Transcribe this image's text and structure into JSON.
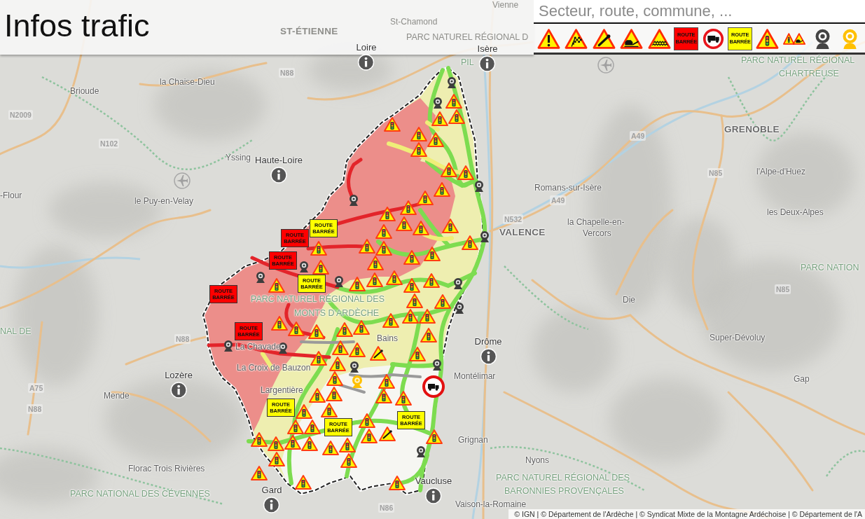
{
  "header": {
    "title": "Infos trafic"
  },
  "search": {
    "placeholder": "Secteur, route, commune, ..."
  },
  "filters": [
    {
      "kind": "danger"
    },
    {
      "kind": "checkered"
    },
    {
      "kind": "tool"
    },
    {
      "kind": "vehicle"
    },
    {
      "kind": "waves"
    },
    {
      "kind": "closure",
      "label": "ROUTE BARRÉE",
      "color": "#ff0000"
    },
    {
      "kind": "prohibition"
    },
    {
      "kind": "closure",
      "label": "ROUTE BARRÉE",
      "color": "#ffff00"
    },
    {
      "kind": "signal"
    },
    {
      "kind": "signals"
    },
    {
      "kind": "webcam",
      "color": "#444444"
    },
    {
      "kind": "webcam",
      "color": "#ffc000"
    }
  ],
  "map": {
    "places": [
      {
        "name": "Vienne",
        "kind": "town"
      },
      {
        "name": "ST-ÉTIENNE",
        "kind": "major"
      },
      {
        "name": "St-Chamond",
        "kind": "town"
      },
      {
        "name": "PARC NATUREL RÉGIONAL D",
        "kind": "park"
      },
      {
        "name": "PIL",
        "kind": "park"
      },
      {
        "name": "Brioude",
        "kind": "town"
      },
      {
        "name": "la Chaise-Dieu",
        "kind": "town"
      },
      {
        "name": "N88",
        "kind": "shield"
      },
      {
        "name": "N2009",
        "kind": "shield"
      },
      {
        "name": "N102",
        "kind": "shield"
      },
      {
        "name": "Yssing",
        "kind": "town"
      },
      {
        "name": "PARC NATUREL RÉGIONAL",
        "kind": "park"
      },
      {
        "name": "CHARTREUSE",
        "kind": "park"
      },
      {
        "name": "GRENOBLE",
        "kind": "major"
      },
      {
        "name": "A49",
        "kind": "shield"
      },
      {
        "name": "N85",
        "kind": "shield"
      },
      {
        "name": "l'Alpe-d'Huez",
        "kind": "town"
      },
      {
        "name": "Romans-sur-Isère",
        "kind": "town"
      },
      {
        "name": "A49",
        "kind": "shield"
      },
      {
        "name": "les Deux-Alpes",
        "kind": "town"
      },
      {
        "name": "N532",
        "kind": "shield"
      },
      {
        "name": "la Chapelle-en-",
        "kind": "town"
      },
      {
        "name": "Vercors",
        "kind": "town"
      },
      {
        "name": "VALENCE",
        "kind": "major"
      },
      {
        "name": "-Flour",
        "kind": "town"
      },
      {
        "name": "le Puy-en-Velay",
        "kind": "town"
      },
      {
        "name": "PARC NATION",
        "kind": "park"
      },
      {
        "name": "PARC NATUREL RÉGIONAL DES",
        "kind": "park"
      },
      {
        "name": "MONTS D'ARDÈCHE",
        "kind": "park"
      },
      {
        "name": "Die",
        "kind": "town"
      },
      {
        "name": "N85",
        "kind": "shield"
      },
      {
        "name": "NAL DE",
        "kind": "park"
      },
      {
        "name": "N88",
        "kind": "shield"
      },
      {
        "name": "Super-Dévoluy",
        "kind": "town"
      },
      {
        "name": "La Chavade",
        "kind": "town"
      },
      {
        "name": "Bains",
        "kind": "town"
      },
      {
        "name": "La Croix de Bauzon",
        "kind": "town"
      },
      {
        "name": "Montélimar",
        "kind": "town"
      },
      {
        "name": "Gap",
        "kind": "town"
      },
      {
        "name": "A75",
        "kind": "shield"
      },
      {
        "name": "Largentière",
        "kind": "town"
      },
      {
        "name": "Mende",
        "kind": "town"
      },
      {
        "name": "N88",
        "kind": "shield"
      },
      {
        "name": "Grignan",
        "kind": "town"
      },
      {
        "name": "Nyons",
        "kind": "town"
      },
      {
        "name": "Florac Trois Rivières",
        "kind": "town"
      },
      {
        "name": "PARC NATUREL RÉGIONAL DES",
        "kind": "park"
      },
      {
        "name": "PARC NATIONAL DES CÉVENNES",
        "kind": "park"
      },
      {
        "name": "BARONNIES PROVENÇALES",
        "kind": "park"
      },
      {
        "name": "N86",
        "kind": "shield"
      },
      {
        "name": "Vaison-la-Romaine",
        "kind": "town"
      }
    ],
    "departments": [
      {
        "name": "Loire"
      },
      {
        "name": "Isère"
      },
      {
        "name": "Haute-Loire"
      },
      {
        "name": "Drôme"
      },
      {
        "name": "Lozère"
      },
      {
        "name": "Vaucluse"
      },
      {
        "name": "Gard"
      }
    ],
    "closures": [
      {
        "label": "ROUTE BARRÉE",
        "color": "#ffff00"
      },
      {
        "label": "ROUTE BARRÉE",
        "color": "#ff0000"
      },
      {
        "label": "ROUTE BARRÉE",
        "color": "#ff0000"
      },
      {
        "label": "ROUTE BARRÉE",
        "color": "#ffff00"
      },
      {
        "label": "ROUTE BARRÉE",
        "color": "#ff0000"
      },
      {
        "label": "ROUTE BARRÉE",
        "color": "#ff0000"
      },
      {
        "label": "ROUTE BARRÉE",
        "color": "#ffff00"
      },
      {
        "label": "ROUTE BARRÉE",
        "color": "#ffff00"
      },
      {
        "label": "ROUTE BARRÉE",
        "color": "#ffff00"
      }
    ]
  },
  "attribution": "© IGN | © Département de l'Ardèche | © Syndicat Mixte de la Montagne Ardéchoise | © Département de l'A"
}
